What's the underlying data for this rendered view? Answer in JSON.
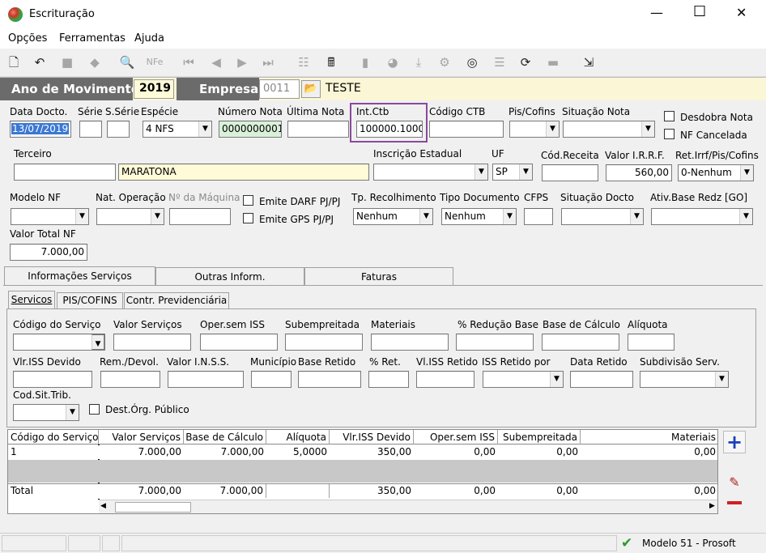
{
  "window": {
    "title": "Escrituração",
    "min": "—",
    "max": "☐",
    "close": "✕"
  },
  "menu": [
    "Opções",
    "Ferramentas",
    "Ajuda"
  ],
  "header": {
    "ano_label": "Ano de Movimento",
    "ano_value": "2019",
    "empresa_label": "Empresa",
    "empresa_code": "0011",
    "empresa_name": "TESTE"
  },
  "row1": {
    "data_docto_label": "Data Docto.",
    "data_docto": "13/07/2019",
    "serie_label": "Série",
    "serie": "",
    "sserie_label": "S.Série",
    "sserie": "",
    "especie_label": "Espécie",
    "especie": "4 NFS",
    "numero_nota_label": "Número Nota",
    "numero_nota": "0000000001",
    "ultima_nota_label": "Última Nota",
    "ultima_nota": "",
    "int_ctb_label": "Int.Ctb",
    "int_ctb": "100000.1000",
    "codigo_ctb_label": "Código CTB",
    "codigo_ctb": "",
    "pis_cofins_label": "Pis/Cofins",
    "pis_cofins": "",
    "situacao_nota_label": "Situação Nota",
    "situacao_nota": "",
    "desdobra_label": "Desdobra Nota",
    "nf_cancelada_label": "NF Cancelada"
  },
  "row2": {
    "terceiro_label": "Terceiro",
    "terceiro_code": "",
    "terceiro_name": "MARATONA",
    "ie_label": "Inscrição Estadual",
    "ie": "",
    "uf_label": "UF",
    "uf": "SP",
    "cod_receita_label": "Cód.Receita",
    "cod_receita": "",
    "valor_irrf_label": "Valor I.R.R.F.",
    "valor_irrf": "560,00",
    "ret_label": "Ret.Irrf/Pis/Cofins",
    "ret": "0-Nenhum"
  },
  "row3": {
    "modelo_nf_label": "Modelo NF",
    "modelo_nf": "",
    "nat_op_label": "Nat. Operação",
    "nat_op": "",
    "maquina_label": "Nº da Máquina",
    "maquina": "",
    "emite_darf_label": "Emite DARF PJ/PJ",
    "emite_gps_label": "Emite GPS PJ/PJ",
    "tp_recolhimento_label": "Tp. Recolhimento",
    "tp_recolhimento": "Nenhum",
    "tipo_documento_label": "Tipo Documento",
    "tipo_documento": "Nenhum",
    "cfps_label": "CFPS",
    "cfps": "",
    "situacao_docto_label": "Situação Docto",
    "situacao_docto": "",
    "ativ_label": "Ativ.Base Redz [GO]",
    "ativ": ""
  },
  "row4": {
    "valor_total_label": "Valor Total NF",
    "valor_total": "7.000,00"
  },
  "tabs": [
    "Informações Serviços",
    "Outras Inform.",
    "Faturas"
  ],
  "subtabs": [
    "Servicos",
    "PIS/COFINS",
    "Contr. Previdenciária"
  ],
  "servicos": {
    "l1": [
      "Código do Serviço",
      "Valor Serviços",
      "Oper.sem ISS",
      "Subempreitada",
      "Materiais",
      "% Redução Base",
      "Base de Cálculo",
      "Alíquota"
    ],
    "l2": [
      "Vlr.ISS Devido",
      "Rem./Devol.",
      "Valor I.N.S.S.",
      "Município",
      "Base Retido",
      "% Ret.",
      "Vl.ISS Retido",
      "ISS Retido por",
      "Data Retido",
      "Subdivisão Serv."
    ],
    "cod_sit_label": "Cod.Sit.Trib.",
    "dest_label": "Dest.Órg. Público"
  },
  "grid": {
    "headers": [
      "Código do Serviço",
      "Valor Serviços",
      "Base de Cálculo",
      "Alíquota",
      "Vlr.ISS Devido",
      "Oper.sem ISS",
      "Subempreitada",
      "Materiais"
    ],
    "row": [
      "1",
      "7.000,00",
      "7.000,00",
      "5,0000",
      "350,00",
      "0,00",
      "0,00",
      "0,00"
    ],
    "total": [
      "Total",
      "7.000,00",
      "7.000,00",
      "",
      "350,00",
      "0,00",
      "0,00",
      "0,00"
    ]
  },
  "status": {
    "text": "Modelo 51 - Prosoft"
  },
  "colors": {
    "header_bar": "#6b6b6b",
    "accent_border": "#8a4a9c",
    "yellow": "#fffbd9",
    "green": "#d9f0d9",
    "add": "#1c3fb8",
    "remove": "#d02020"
  }
}
